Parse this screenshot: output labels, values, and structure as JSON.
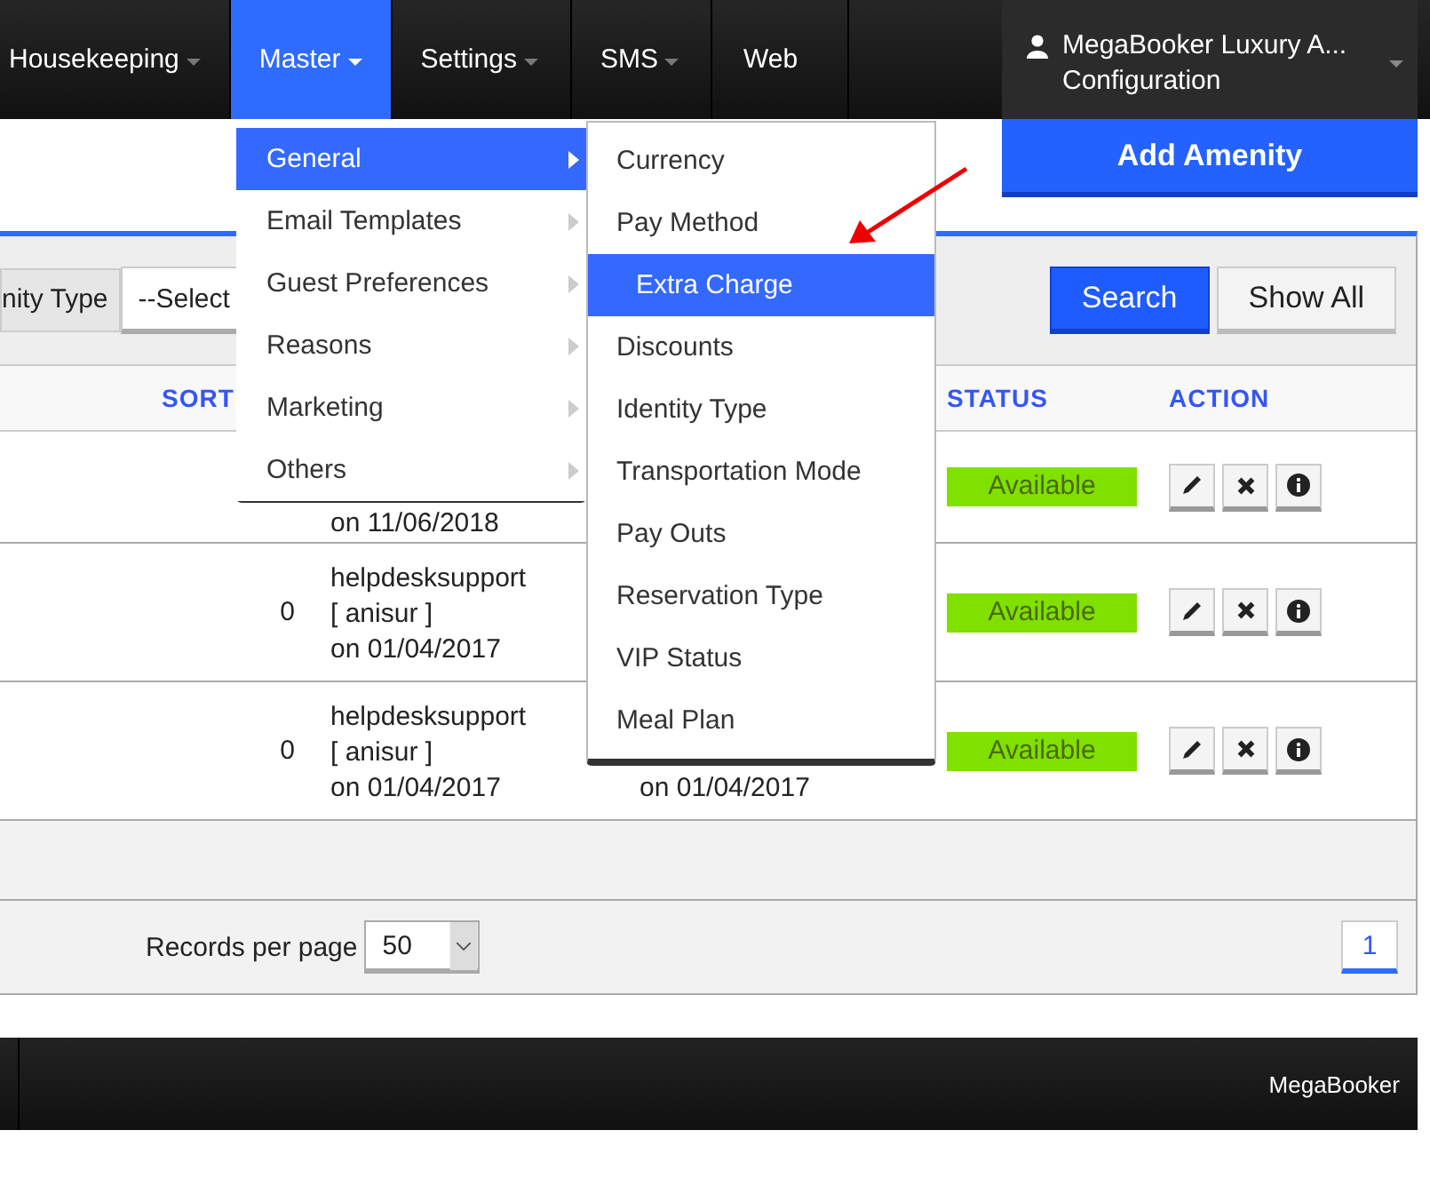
{
  "navbar": {
    "items": [
      {
        "label": "Housekeeping",
        "dropdown": true,
        "selected": false
      },
      {
        "label": "Master",
        "dropdown": true,
        "selected": true
      },
      {
        "label": "Settings",
        "dropdown": true,
        "selected": false
      },
      {
        "label": "SMS",
        "dropdown": true,
        "selected": false
      },
      {
        "label": "Web",
        "dropdown": false,
        "selected": false
      }
    ],
    "user": {
      "name": "MegaBooker Luxury A...",
      "role": "Configuration"
    }
  },
  "master_menu": {
    "items": [
      {
        "label": "General",
        "selected": true
      },
      {
        "label": "Email Templates",
        "selected": false
      },
      {
        "label": "Guest Preferences",
        "selected": false
      },
      {
        "label": "Reasons",
        "selected": false
      },
      {
        "label": "Marketing",
        "selected": false
      },
      {
        "label": "Others",
        "selected": false
      }
    ]
  },
  "general_submenu": {
    "items": [
      {
        "label": "Currency",
        "selected": false
      },
      {
        "label": "Pay Method",
        "selected": false
      },
      {
        "label": "Extra Charge",
        "selected": true
      },
      {
        "label": "Discounts",
        "selected": false
      },
      {
        "label": "Identity Type",
        "selected": false
      },
      {
        "label": "Transportation Mode",
        "selected": false
      },
      {
        "label": "Pay Outs",
        "selected": false
      },
      {
        "label": "Reservation Type",
        "selected": false
      },
      {
        "label": "VIP Status",
        "selected": false
      },
      {
        "label": "Meal Plan",
        "selected": false
      }
    ]
  },
  "add_button": "Add Amenity",
  "filter": {
    "label": "nity Type",
    "select_value": "--Select",
    "buttons": [
      "Search",
      "Show All"
    ]
  },
  "table": {
    "columns": [
      "SORT",
      "STATUS",
      "ACTION"
    ],
    "rows": [
      {
        "created": [
          "on 11/06/2018"
        ],
        "status": "Available"
      },
      {
        "sort": "0",
        "created": [
          "helpdesksupport",
          "[ anisur ]",
          "on 01/04/2017"
        ],
        "status": "Available"
      },
      {
        "sort": "0",
        "created": [
          "helpdesksupport",
          "[ anisur ]",
          "on 01/04/2017"
        ],
        "updated": [
          "on 01/04/2017"
        ],
        "status": "Available"
      }
    ]
  },
  "pagination": {
    "records_label": "Records per page",
    "records_value": "50",
    "pages": [
      {
        "label": "1",
        "selected": true
      }
    ]
  },
  "footer": {
    "brand": "MegaBooker"
  }
}
